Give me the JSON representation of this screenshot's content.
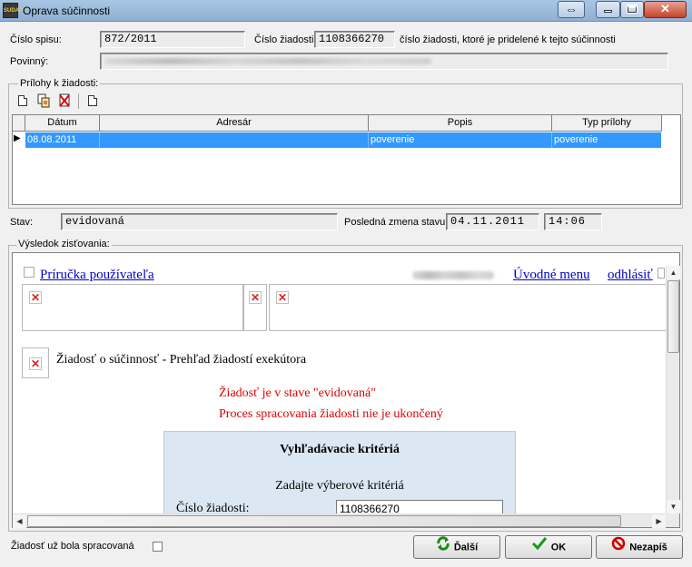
{
  "window": {
    "title": "Oprava súčinnosti",
    "icon_label": "SUDAS",
    "resize_glyph": "⇔",
    "close_glyph": "✕"
  },
  "form": {
    "cislo_spisu_label": "Číslo spisu:",
    "cislo_spisu_value": "872/2011",
    "cislo_ziadosti_label": "Číslo žiadosti:",
    "cislo_ziadosti_value": "1108366270",
    "cislo_ziadosti_hint": "číslo žiadosti, ktoré je pridelené k tejto súčinnosti",
    "povinny_label": "Povinný:",
    "stav_label": "Stav:",
    "stav_value": "evidovaná",
    "posledna_zmena_label": "Posledná zmena stavu:",
    "posledna_zmena_date": "04.11.2011",
    "posledna_zmena_time": "14:06"
  },
  "attachments": {
    "group_title": "Prílohy k žiadosti:",
    "columns": [
      "Dátum",
      "Adresár",
      "Popis",
      "Typ prílohy"
    ],
    "rows": [
      {
        "datum": "08.08.2011",
        "adresar": "",
        "popis": "poverenie",
        "typ": "poverenie"
      }
    ],
    "row_marker": "▶"
  },
  "result": {
    "group_title": "Výsledok zisťovania:",
    "web": {
      "link_manual": "Príručka používateľa",
      "link_menu": "Úvodné menu",
      "link_logout": "odhlásiť",
      "page_heading": "Žiadosť o súčinnosť - Prehľad žiadostí exekútora",
      "state_msg": "Žiadosť je v stave \"evidovaná\"",
      "process_msg": "Proces spracovania žiadosti nie je ukončený",
      "criteria_title": "Vyhľadávacie kritériá",
      "criteria_sub": "Zadajte výberové kritériá",
      "criteria_field_label": "Číslo žiadosti:",
      "criteria_field_value": "1108366270",
      "broken_image_glyph": "✕"
    }
  },
  "footer": {
    "processed_label": "Žiadosť už bola spracovaná",
    "btn_next": "Ďalší",
    "btn_ok": "OK",
    "btn_cancel": "Nezapíš"
  },
  "colors": {
    "selection": "#3399ff",
    "error_text": "#dd0000",
    "link": "#0000cc",
    "criteria_bg": "#dbe7f3"
  }
}
